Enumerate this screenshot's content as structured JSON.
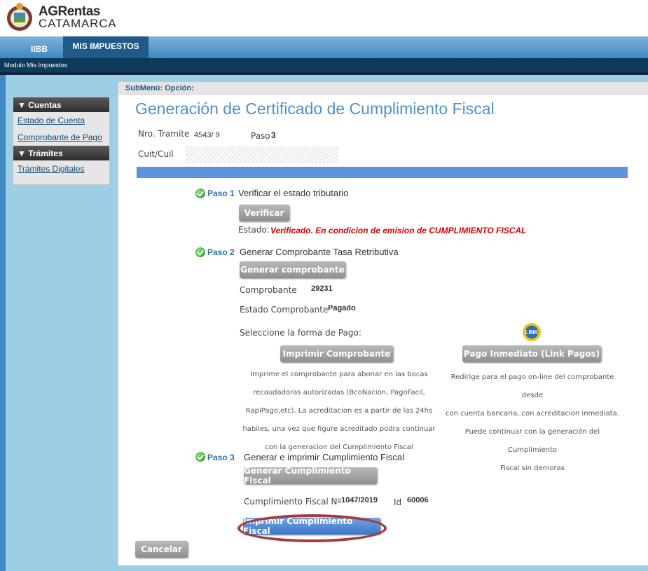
{
  "header": {
    "brand_title": "AGRentas",
    "brand_subtitle": "CATAMARCA"
  },
  "topnav": {
    "tabs": [
      {
        "label": "IIBB"
      },
      {
        "label": "MIS IMPUESTOS"
      }
    ]
  },
  "module_bar": {
    "label": "Modulo Mis Impuestos"
  },
  "sidebar": {
    "sections": [
      {
        "title": "▼ Cuentas",
        "items": [
          "Estado de Cuenta",
          "Comprobante de Pago"
        ]
      },
      {
        "title": "▼ Trámites",
        "items": [
          "Trámites Digitales"
        ]
      }
    ]
  },
  "main": {
    "submenu": "SubMenú: Opción:",
    "title": "Generación de Certificado de Cumplimiento Fiscal",
    "nro_tramite_label": "Nro. Tramite",
    "nro_tramite_value": "4543/ 9",
    "paso_label": "Paso",
    "paso_value": "3",
    "cuit_label": "Cuit/Cuil",
    "step1": {
      "paso": "Paso 1",
      "title": "Verificar el estado tributario",
      "button": "Verificar",
      "estado_label": "Estado:",
      "estado_value": "Verificado. En condicion de emision de CUMPLIMIENTO FISCAL"
    },
    "step2": {
      "paso": "Paso 2",
      "title": "Generar Comprobante Tasa Retributiva",
      "button": "Generar comprobante",
      "comprobante_label": "Comprobante",
      "comprobante_value": "29231",
      "estado_label": "Estado Comprobante",
      "estado_value": "Pagado",
      "forma_pago_label": "Seleccione la forma de Pago:",
      "link_icon_text": "LINK",
      "imprimir_button": "Imprimir Comprobante",
      "pago_button": "Pago Inmediato (Link Pagos)",
      "imprimir_desc": [
        "Imprime el comprobante para abonar en las bocas",
        "recaudadoras autorizadas (BcoNacion, PagoFacil,",
        "RapiPago,etc). La acreditacion es a partir de las 24hs",
        "habiles, una vez que figure acreditado podra continuar",
        "con la generacion del Cumplimiento Fiscal"
      ],
      "pago_desc": [
        "Redirige para el pago on-line del comprobante desde",
        "con cuenta bancaria, con acreditacion inmediata.",
        "Puede continuar con la generación del Cumplimiento",
        "Fiscal sin demoras"
      ]
    },
    "step3": {
      "paso": "Paso 3",
      "title": "Generar e imprimir Cumplimiento Fiscal",
      "button": "Generar Cumplimiento Fiscal",
      "cf_label": "Cumplimiento Fiscal Nº",
      "cf_value": "1047/2019",
      "id_label": "Id",
      "id_value": "60006",
      "print_button": "Imprimir Cumplimiento Fiscal"
    },
    "cancel_button": "Cancelar"
  }
}
